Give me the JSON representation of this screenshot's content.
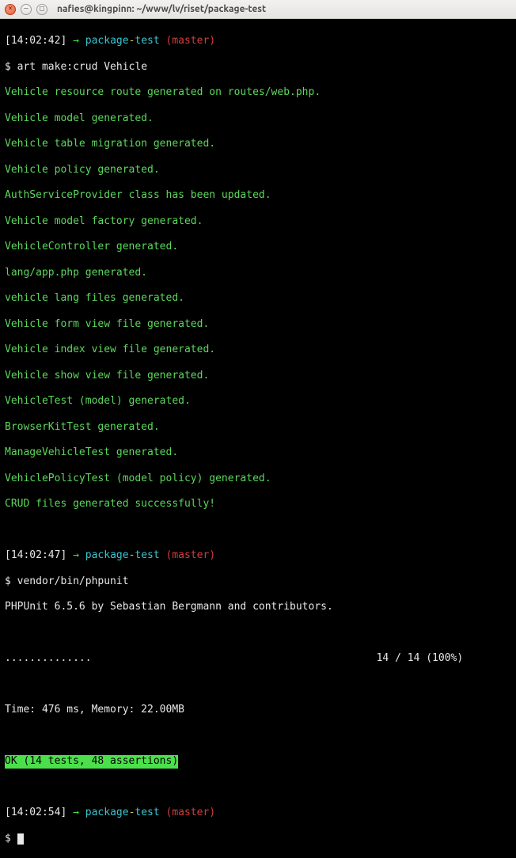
{
  "window": {
    "title": "nafies@kingpinn: ~/www/lv/riset/package-test"
  },
  "prompt1": {
    "time": "[14:02:42]",
    "arrow": "→",
    "dir": "package",
    "dash": "-",
    "dir2": "test",
    "branch": "(master)",
    "ps": "$",
    "cmd": "art make:crud Vehicle"
  },
  "crud_output": [
    "Vehicle resource route generated on routes/web.php.",
    "Vehicle model generated.",
    "Vehicle table migration generated.",
    "Vehicle policy generated.",
    "AuthServiceProvider class has been updated.",
    "Vehicle model factory generated.",
    "VehicleController generated.",
    "lang/app.php generated.",
    "vehicle lang files generated.",
    "Vehicle form view file generated.",
    "Vehicle index view file generated.",
    "Vehicle show view file generated.",
    "VehicleTest (model) generated.",
    "BrowserKitTest generated.",
    "ManageVehicleTest generated.",
    "VehiclePolicyTest (model policy) generated.",
    "CRUD files generated successfully!"
  ],
  "prompt2": {
    "time": "[14:02:47]",
    "arrow": "→",
    "dir": "package",
    "dash": "-",
    "dir2": "test",
    "branch": "(master)",
    "ps": "$",
    "cmd": "vendor/bin/phpunit"
  },
  "phpunit": {
    "header": "PHPUnit 6.5.6 by Sebastian Bergmann and contributors.",
    "dots": "..............",
    "result": "14 / 14 (100%)",
    "time": "Time: 476 ms, Memory: 22.00MB",
    "ok": "OK (14 tests, 48 assertions)"
  },
  "prompt3": {
    "time": "[14:02:54]",
    "arrow": "→",
    "dir": "package",
    "dash": "-",
    "dir2": "test",
    "branch": "(master)",
    "ps": "$"
  }
}
